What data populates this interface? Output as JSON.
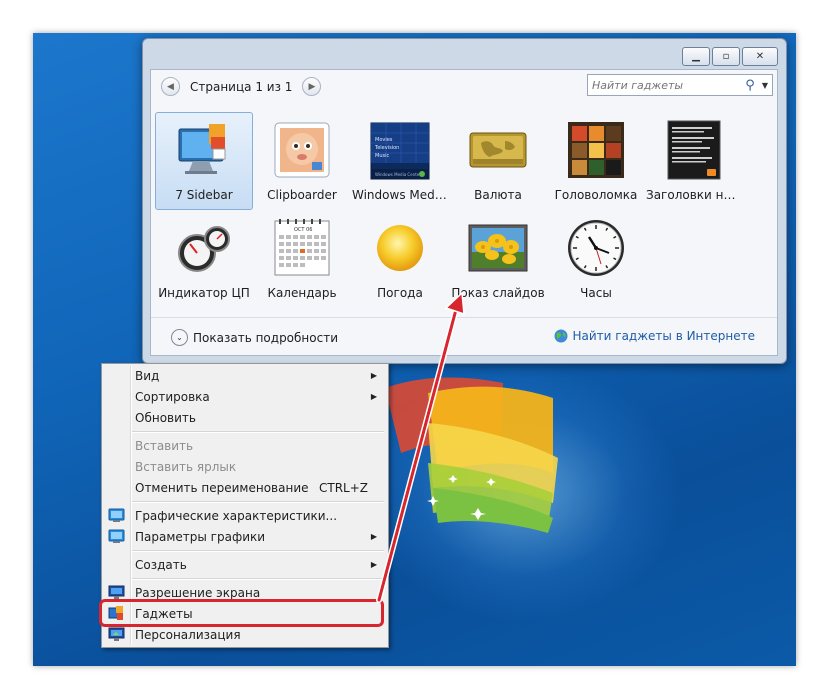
{
  "window": {
    "controls": {
      "minimize": "▁",
      "maximize": "▫",
      "close": "✕"
    },
    "nav": {
      "prev_icon": "◀",
      "next_icon": "▶",
      "page_label": "Страница 1 из 1"
    },
    "search": {
      "placeholder": "Найти гаджеты",
      "icon": "⚲",
      "dropdown_icon": "▼"
    },
    "gadgets": [
      {
        "label": "7 Sidebar",
        "selected": true
      },
      {
        "label": "Clipboarder"
      },
      {
        "label": "Windows Media..."
      },
      {
        "label": "Валюта"
      },
      {
        "label": "Головоломка"
      },
      {
        "label": "Заголовки нов..."
      },
      {
        "label": "Индикатор ЦП"
      },
      {
        "label": "Календарь"
      },
      {
        "label": "Погода"
      },
      {
        "label": "Показ слайдов"
      },
      {
        "label": "Часы"
      }
    ],
    "thumb_text": {
      "media_lines": [
        "Movies",
        "Television",
        "Music"
      ],
      "media_footer": "Windows Media Center",
      "calendar_month": "OCT 06"
    },
    "footer": {
      "details_chevron": "⌄",
      "details_label": "Показать подробности",
      "online_link": "Найти гаджеты в Интернете"
    }
  },
  "context_menu": {
    "items": [
      {
        "label": "Вид",
        "submenu": "▶"
      },
      {
        "label": "Сортировка",
        "submenu": "▶"
      },
      {
        "label": "Обновить"
      },
      {
        "label": "Вставить"
      },
      {
        "label": "Вставить ярлык"
      },
      {
        "label": "Отменить переименование",
        "shortcut": "CTRL+Z"
      },
      {
        "label": "Графические характеристики..."
      },
      {
        "label": "Параметры графики",
        "submenu": "▶"
      },
      {
        "label": "Создать",
        "submenu": "▶"
      },
      {
        "label": "Разрешение экрана"
      },
      {
        "label": "Гаджеты"
      },
      {
        "label": "Персонализация"
      }
    ]
  },
  "colors": {
    "highlight": "#d7262e",
    "desktop": "#1065b8",
    "link": "#1f5ca8"
  }
}
